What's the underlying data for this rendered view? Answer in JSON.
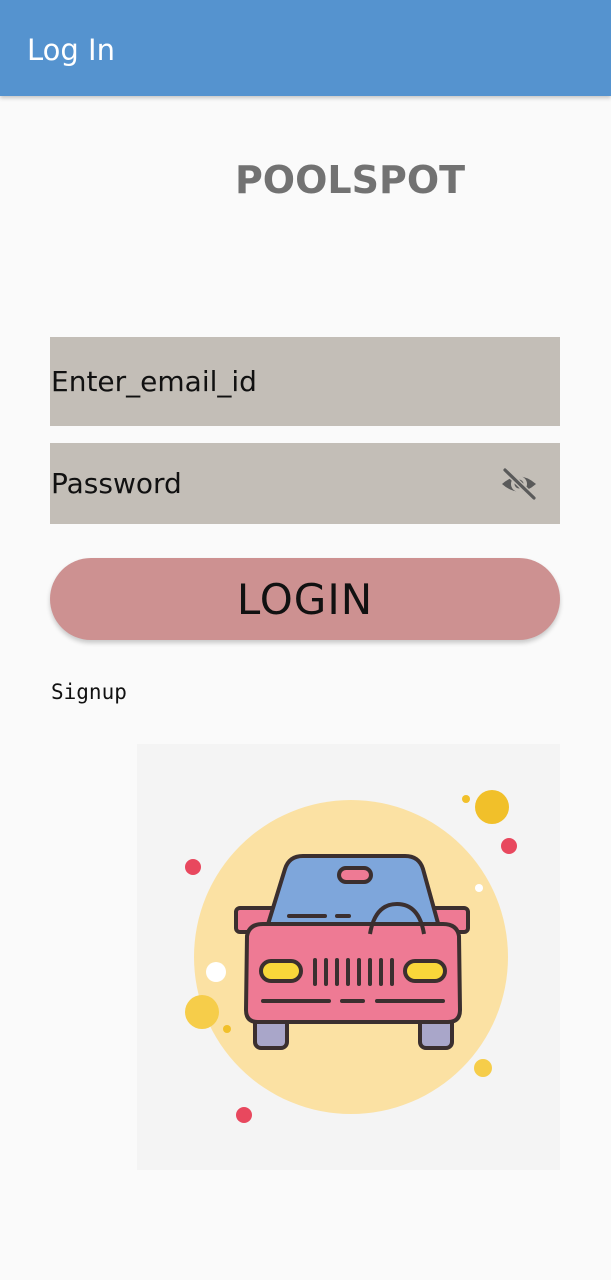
{
  "app_bar": {
    "title": "Log In"
  },
  "brand": {
    "name": "POOLSPOT"
  },
  "form": {
    "email_placeholder": "Enter_email_id",
    "email_value": "",
    "password_placeholder": "Password",
    "password_value": "",
    "visibility_icon": "eye-off-icon",
    "login_label": "LOGIN",
    "signup_label": "Signup"
  },
  "illustration": {
    "icon": "car-icon"
  },
  "colors": {
    "app_bar": "#5593cf",
    "brand_text": "#727272",
    "field_background": "#c3beb7",
    "login_button": "#cd9191",
    "car_body": "#ee7a94",
    "car_roof": "#7ea6db",
    "circle": "#fbe1a3"
  }
}
